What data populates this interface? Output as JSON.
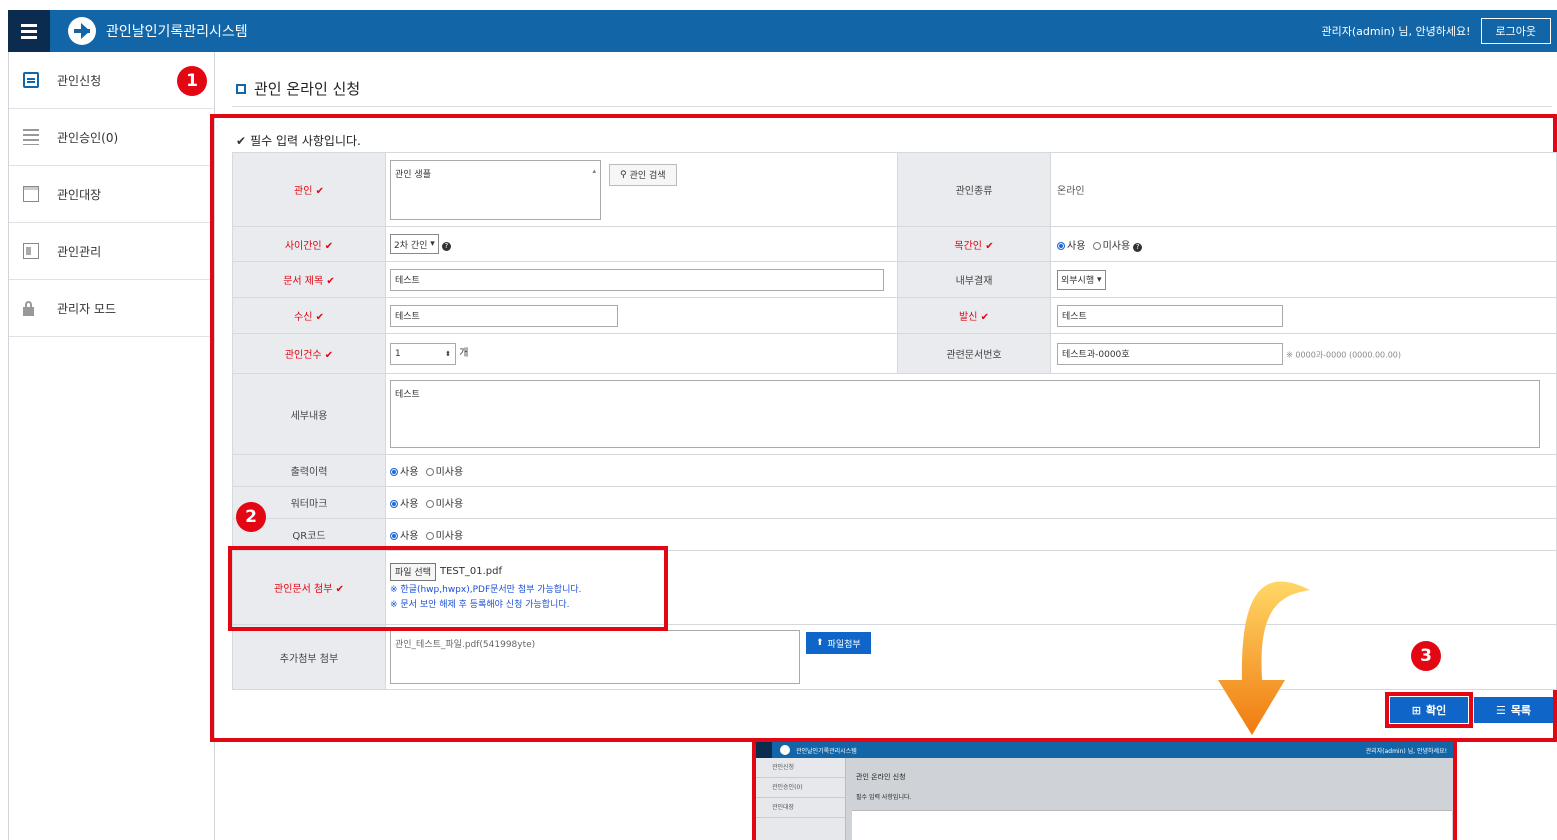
{
  "header": {
    "app_title": "관인날인기록관리시스템",
    "welcome": "관리자(admin) 님, 안녕하세요!",
    "logout_label": "로그아웃"
  },
  "sidebar": {
    "items": [
      {
        "label": "관인신청",
        "icon": "document-icon"
      },
      {
        "label": "관인승인(0)",
        "icon": "list-icon"
      },
      {
        "label": "관인대장",
        "icon": "ledger-icon"
      },
      {
        "label": "관인관리",
        "icon": "id-card-icon"
      },
      {
        "label": "관리자 모드",
        "icon": "lock-icon"
      }
    ]
  },
  "page": {
    "title": "관인 온라인 신청",
    "required_note": "필수 입력 사항입니다."
  },
  "badges": [
    "1",
    "2",
    "3"
  ],
  "form": {
    "seal_label": "관인",
    "seal_placeholder": "관인 생플",
    "seal_search_label": "관인 검색",
    "seal_type_label": "관인종류",
    "seal_type_value": "온라인",
    "middle_seal_label": "사이간인",
    "middle_seal_value": "2차 간인",
    "half_seal_label": "목간인",
    "use_label": "사용",
    "nouse_label": "미사용",
    "doc_title_label": "문서 제목",
    "doc_title_value": "테스트",
    "internal_approval_label": "내부결재",
    "internal_approval_value": "외부시행",
    "receiver_label": "수신",
    "receiver_value": "테스트",
    "sender_label": "발신",
    "sender_value": "테스트",
    "seal_count_label": "관인건수",
    "seal_count_value": "1",
    "seal_count_unit": "개",
    "related_doc_label": "관련문서번호",
    "related_doc_value": "테스트과-0000호",
    "related_doc_hint": "※ 0000과-0000 (0000.00.00)",
    "detail_label": "세부내용",
    "detail_value": "테스트",
    "print_history_label": "출력이력",
    "watermark_label": "워터마크",
    "qrcode_label": "QR코드",
    "attach_label": "관인문서 첨부",
    "file_select_label": "파일 선택",
    "file_name": "TEST_01.pdf",
    "notice_1": "※ 한글(hwp,hwpx),PDF문서만 첨부 가능합니다.",
    "notice_2": "※ 문서 보안 해제 후 등록해야 신청 가능합니다.",
    "extra_attach_label": "추가첨부 첨부",
    "extra_attach_value": "관인_테스트_파일.pdf(541998yte)",
    "extra_attach_button": "파일첨부"
  },
  "actions": {
    "confirm_label": "확인",
    "list_label": "목록"
  },
  "thumbnail": {
    "app_title": "관인날인기록관리시스템",
    "welcome": "관리자(admin) 님, 안녕하세요!",
    "page_title": "관인 온라인 신청",
    "required_note": "필수 입력 사항입니다."
  },
  "colors": {
    "header_blue": "#1266a8",
    "accent_red": "#e30613",
    "button_blue": "#0f66c8"
  }
}
